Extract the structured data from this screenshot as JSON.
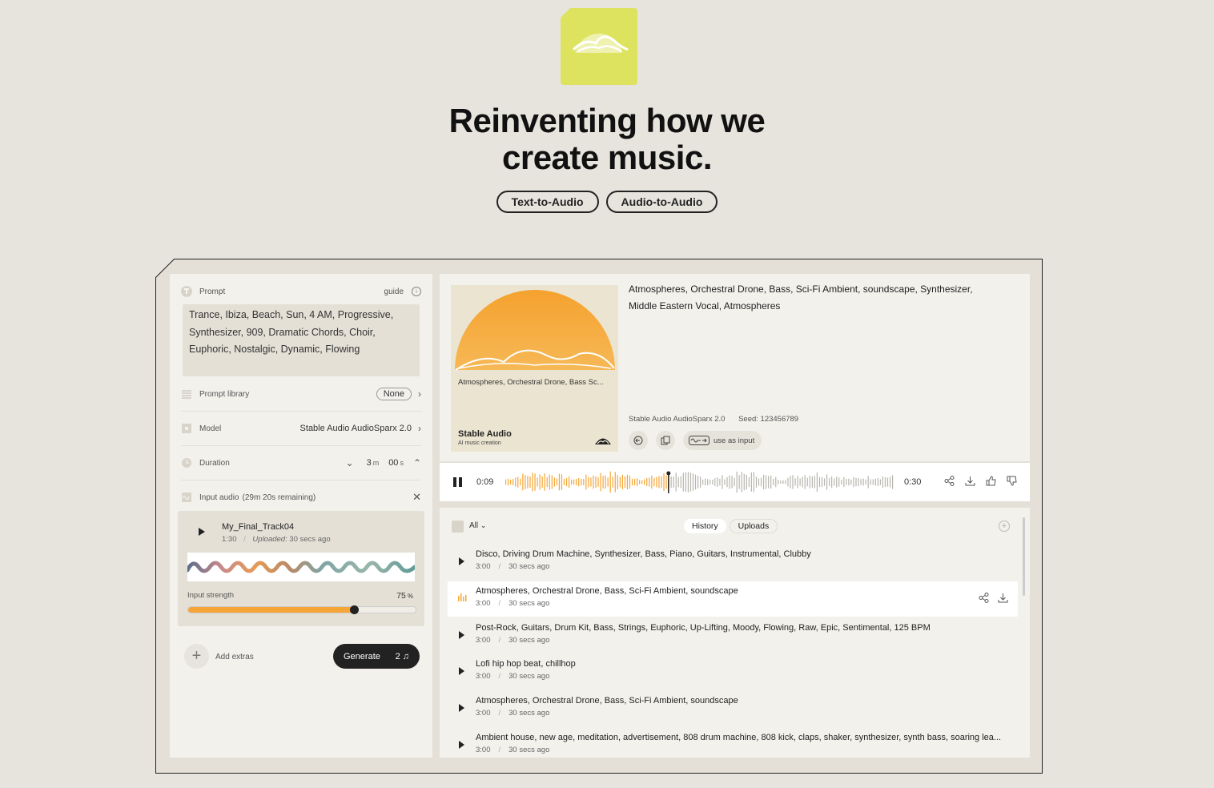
{
  "hero": {
    "line1": "Reinventing how we",
    "line2": "create music."
  },
  "nav": {
    "text_to_audio": "Text-to-Audio",
    "audio_to_audio": "Audio-to-Audio"
  },
  "colors": {
    "accent": "#f5a536",
    "logo_bg": "#dde35e",
    "dark": "#222222"
  },
  "left": {
    "prompt_label": "Prompt",
    "guide": "guide",
    "prompt_text": "Trance, Ibiza, Beach, Sun, 4 AM, Progressive, Synthesizer, 909, Dramatic Chords, Choir, Euphoric, Nostalgic, Dynamic, Flowing",
    "library_label": "Prompt library",
    "library_value": "None",
    "model_label": "Model",
    "model_value": "Stable Audio AudioSparx 2.0",
    "duration_label": "Duration",
    "duration_min": "3",
    "duration_min_unit": "m",
    "duration_sec": "00",
    "duration_sec_unit": "s",
    "input_audio_label": "Input audio",
    "input_audio_remaining": "(29m 20s remaining)",
    "track_name": "My_Final_Track04",
    "track_length": "1:30",
    "track_uploaded_label": "Uploaded:",
    "track_uploaded": "30 secs ago",
    "strength_label": "Input strength",
    "strength_value": "75",
    "strength_unit": "%",
    "strength_fraction": 0.73,
    "add_extras": "Add extras",
    "generate": "Generate",
    "generate_count": "2"
  },
  "current": {
    "cover_caption": "Atmospheres, Orchestral Drone, Bass Sc...",
    "cover_brand": "Stable Audio",
    "cover_sub": "AI music creation",
    "title": "Atmospheres, Orchestral Drone, Bass, Sci-Fi Ambient, soundscape, Synthesizer, Middle Eastern Vocal, Atmospheres",
    "model": "Stable Audio AudioSparx 2.0",
    "seed": "Seed: 123456789",
    "use_as_input": "use as input"
  },
  "player": {
    "elapsed": "0:09",
    "total": "0:30",
    "progress": 0.42
  },
  "history": {
    "filter": "All",
    "tab_history": "History",
    "tab_uploads": "Uploads",
    "items": [
      {
        "title": "Disco, Driving Drum Machine, Synthesizer, Bass, Piano, Guitars, Instrumental, Clubby",
        "duration": "3:00",
        "time": "30 secs ago"
      },
      {
        "title": "Atmospheres, Orchestral Drone, Bass, Sci-Fi Ambient, soundscape",
        "duration": "3:00",
        "time": "30 secs ago"
      },
      {
        "title": "Post-Rock, Guitars, Drum Kit, Bass, Strings, Euphoric, Up-Lifting, Moody, Flowing, Raw, Epic, Sentimental, 125 BPM",
        "duration": "3:00",
        "time": "30 secs ago"
      },
      {
        "title": "Lofi hip hop beat, chillhop",
        "duration": "3:00",
        "time": "30 secs ago"
      },
      {
        "title": "Atmospheres, Orchestral Drone, Bass, Sci-Fi Ambient, soundscape",
        "duration": "3:00",
        "time": "30 secs ago"
      },
      {
        "title": "Ambient house, new age, meditation, advertisement, 808 drum machine, 808 kick, claps, shaker, synthesizer, synth bass, soaring lea...",
        "duration": "3:00",
        "time": "30 secs ago"
      }
    ]
  }
}
